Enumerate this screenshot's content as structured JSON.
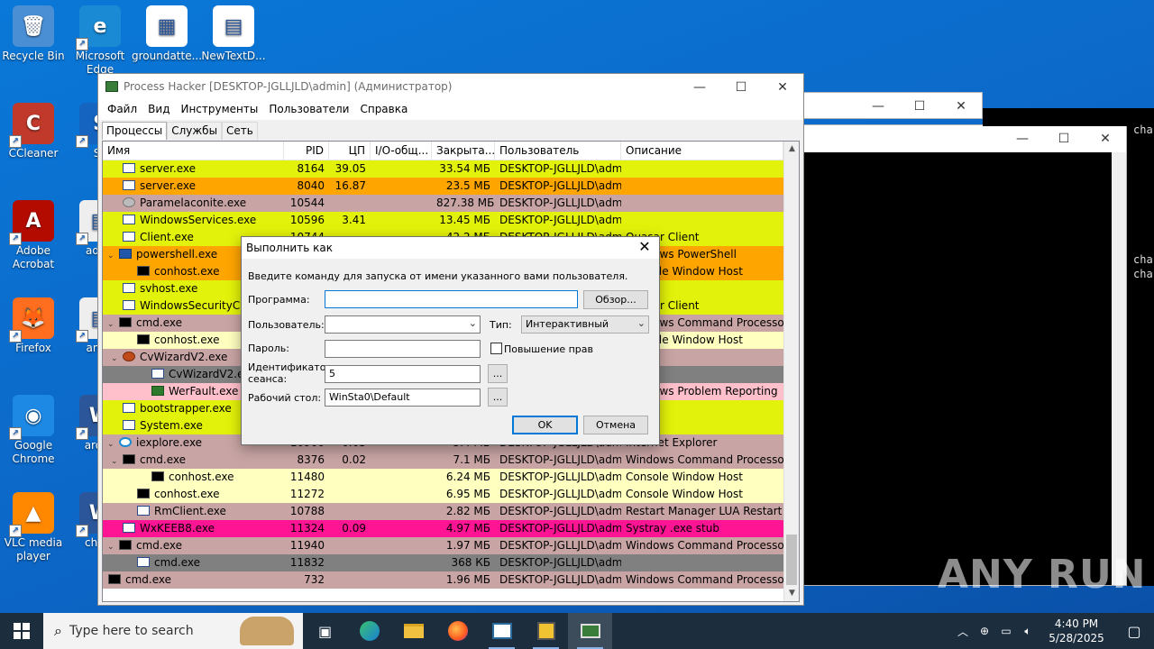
{
  "desktop": {
    "icons": [
      {
        "label": "Recycle Bin"
      },
      {
        "label": "Microsoft Edge"
      },
      {
        "label": "groundatte..."
      },
      {
        "label": "NewTextD..."
      },
      {
        "label": "CCleaner"
      },
      {
        "label": "Sk"
      },
      {
        "label": "Adobe Acrobat"
      },
      {
        "label": "advic"
      },
      {
        "label": "Firefox"
      },
      {
        "label": "answ"
      },
      {
        "label": "Google Chrome"
      },
      {
        "label": "aroun"
      },
      {
        "label": "VLC media player"
      },
      {
        "label": "charg"
      }
    ],
    "console_text": [
      "cha",
      "cha",
      "cha"
    ],
    "watermark": "ANY RUN"
  },
  "process_hacker": {
    "title": "Process Hacker [DESKTOP-JGLLJLD\\admin] (Администратор)",
    "menu": [
      "Файл",
      "Вид",
      "Инструменты",
      "Пользователи",
      "Справка"
    ],
    "tabs": [
      "Процессы",
      "Службы",
      "Сеть"
    ],
    "columns": [
      "Имя",
      "PID",
      "ЦП",
      "I/O-общ...",
      "Закрыта...",
      "Пользователь",
      "Описание"
    ],
    "rows": [
      {
        "name": "server.exe",
        "pid": "8164",
        "cpu": "39.05",
        "io": "",
        "mem": "33.54 МБ",
        "user": "DESKTOP-JGLLJLD\\admi",
        "desc": "",
        "bg": "#e3f20a",
        "indent": 1,
        "icon": "app",
        "expander": ""
      },
      {
        "name": "server.exe",
        "pid": "8040",
        "cpu": "16.87",
        "io": "",
        "mem": "23.5 МБ",
        "user": "DESKTOP-JGLLJLD\\admi",
        "desc": "",
        "bg": "#ffa500",
        "indent": 1,
        "icon": "app",
        "expander": ""
      },
      {
        "name": "Paramelaconite.exe",
        "pid": "10544",
        "cpu": "",
        "io": "",
        "mem": "827.38 МБ",
        "user": "DESKTOP-JGLLJLD\\admi",
        "desc": "",
        "bg": "#c8a4a4",
        "indent": 1,
        "icon": "gear",
        "expander": ""
      },
      {
        "name": "WindowsServices.exe",
        "pid": "10596",
        "cpu": "3.41",
        "io": "",
        "mem": "13.45 МБ",
        "user": "DESKTOP-JGLLJLD\\admi",
        "desc": "",
        "bg": "#e3f20a",
        "indent": 1,
        "icon": "app",
        "expander": ""
      },
      {
        "name": "Client.exe",
        "pid": "10744",
        "cpu": "",
        "io": "",
        "mem": "42.2 МБ",
        "user": "DESKTOP-JGLLJLD\\admi",
        "desc": "Quasar Client",
        "bg": "#e3f20a",
        "indent": 1,
        "icon": "app",
        "expander": ""
      },
      {
        "name": "powershell.exe",
        "pid": "",
        "cpu": "",
        "io": "",
        "mem": "",
        "user": "",
        "desc": "Windows PowerShell",
        "bg": "#ffa500",
        "indent": 0,
        "icon": "ps",
        "expander": "⌄"
      },
      {
        "name": "conhost.exe",
        "pid": "",
        "cpu": "",
        "io": "",
        "mem": "",
        "user": "",
        "desc": "Console Window Host",
        "bg": "#ffa500",
        "indent": 2,
        "icon": "cmd",
        "expander": ""
      },
      {
        "name": "svhost.exe",
        "pid": "",
        "cpu": "",
        "io": "",
        "mem": "",
        "user": "",
        "desc": "",
        "bg": "#e3f20a",
        "indent": 1,
        "icon": "app",
        "expander": ""
      },
      {
        "name": "WindowsSecurityChe",
        "pid": "",
        "cpu": "",
        "io": "",
        "mem": "",
        "user": "",
        "desc": "Quasar Client",
        "bg": "#e3f20a",
        "indent": 1,
        "icon": "app",
        "expander": ""
      },
      {
        "name": "cmd.exe",
        "pid": "",
        "cpu": "",
        "io": "",
        "mem": "",
        "user": "",
        "desc": "Windows Command Processor",
        "bg": "#c8a4a4",
        "indent": 0,
        "icon": "cmd",
        "expander": "⌄"
      },
      {
        "name": "conhost.exe",
        "pid": "",
        "cpu": "",
        "io": "",
        "mem": "",
        "user": "",
        "desc": "Console Window Host",
        "bg": "#ffffc0",
        "indent": 2,
        "icon": "cmd",
        "expander": ""
      },
      {
        "name": "CvWizardV2.exe",
        "pid": "",
        "cpu": "",
        "io": "",
        "mem": "",
        "user": "",
        "desc": "",
        "bg": "#c8a4a4",
        "indent": 1,
        "icon": "java",
        "expander": "⌄"
      },
      {
        "name": "CvWizardV2.exe",
        "pid": "",
        "cpu": "",
        "io": "",
        "mem": "",
        "user": "",
        "desc": "",
        "bg": "#808080",
        "indent": 3,
        "icon": "app",
        "expander": ""
      },
      {
        "name": "WerFault.exe",
        "pid": "",
        "cpu": "",
        "io": "",
        "mem": "",
        "user": "",
        "desc": "Windows Problem Reporting",
        "bg": "#ffc0cb",
        "indent": 3,
        "icon": "shield",
        "expander": ""
      },
      {
        "name": "bootstrapper.exe",
        "pid": "",
        "cpu": "",
        "io": "",
        "mem": "",
        "user": "",
        "desc": "",
        "bg": "#e3f20a",
        "indent": 1,
        "icon": "app",
        "expander": ""
      },
      {
        "name": "System.exe",
        "pid": "",
        "cpu": "",
        "io": "",
        "mem": "",
        "user": "",
        "desc": "",
        "bg": "#e3f20a",
        "indent": 1,
        "icon": "app",
        "expander": ""
      },
      {
        "name": "iexplore.exe",
        "pid": "10900",
        "cpu": "0.05",
        "io": "",
        "mem": "3.4 МБ",
        "user": "DESKTOP-JGLLJLD\\admi",
        "desc": "Internet Explorer",
        "bg": "#c8a4a4",
        "indent": 0,
        "icon": "ie",
        "expander": "⌄"
      },
      {
        "name": "cmd.exe",
        "pid": "8376",
        "cpu": "0.02",
        "io": "",
        "mem": "7.1 МБ",
        "user": "DESKTOP-JGLLJLD\\admi",
        "desc": "Windows Command Processor",
        "bg": "#c8a4a4",
        "indent": 1,
        "icon": "cmd",
        "expander": "⌄"
      },
      {
        "name": "conhost.exe",
        "pid": "11480",
        "cpu": "",
        "io": "",
        "mem": "6.24 МБ",
        "user": "DESKTOP-JGLLJLD\\admi",
        "desc": "Console Window Host",
        "bg": "#ffffc0",
        "indent": 3,
        "icon": "cmd",
        "expander": ""
      },
      {
        "name": "conhost.exe",
        "pid": "11272",
        "cpu": "",
        "io": "",
        "mem": "6.95 МБ",
        "user": "DESKTOP-JGLLJLD\\admi",
        "desc": "Console Window Host",
        "bg": "#ffffc0",
        "indent": 2,
        "icon": "cmd",
        "expander": ""
      },
      {
        "name": "RmClient.exe",
        "pid": "10788",
        "cpu": "",
        "io": "",
        "mem": "2.82 МБ",
        "user": "DESKTOP-JGLLJLD\\admi",
        "desc": "Restart Manager LUA Restart ...",
        "bg": "#c8a4a4",
        "indent": 2,
        "icon": "app",
        "expander": ""
      },
      {
        "name": "WxKEEB8.exe",
        "pid": "11324",
        "cpu": "0.09",
        "io": "",
        "mem": "4.97 МБ",
        "user": "DESKTOP-JGLLJLD\\admi",
        "desc": "Systray .exe stub",
        "bg": "#ff1493",
        "indent": 1,
        "icon": "app",
        "expander": ""
      },
      {
        "name": "cmd.exe",
        "pid": "11940",
        "cpu": "",
        "io": "",
        "mem": "1.97 МБ",
        "user": "DESKTOP-JGLLJLD\\admi",
        "desc": "Windows Command Processor",
        "bg": "#c8a4a4",
        "indent": 0,
        "icon": "cmd",
        "expander": "⌄"
      },
      {
        "name": "cmd.exe",
        "pid": "11832",
        "cpu": "",
        "io": "",
        "mem": "368 КБ",
        "user": "DESKTOP-JGLLJLD\\admi",
        "desc": "",
        "bg": "#808080",
        "indent": 2,
        "icon": "app",
        "expander": ""
      },
      {
        "name": "cmd.exe",
        "pid": "732",
        "cpu": "",
        "io": "",
        "mem": "1.96 МБ",
        "user": "DESKTOP-JGLLJLD\\admi",
        "desc": "Windows Command Processor",
        "bg": "#c8a4a4",
        "indent": 0,
        "icon": "cmd",
        "expander": ""
      }
    ]
  },
  "run_as": {
    "title": "Выполнить как",
    "instruction": "Введите команду для запуска от имени указанного вами пользователя.",
    "program_label": "Программа:",
    "program_value": "",
    "browse_label": "Обзор...",
    "user_label": "Пользователь:",
    "user_value": "",
    "type_label": "Тип:",
    "type_value": "Интерактивный",
    "password_label": "Пароль:",
    "elevate_label": "Повышение прав",
    "session_label": "Идентификатор сеанса:",
    "session_value": "5",
    "desktop_label": "Рабочий стол:",
    "desktop_value": "WinSta0\\Default",
    "ellipsis": "...",
    "ok_label": "OK",
    "cancel_label": "Отмена"
  },
  "taskbar": {
    "search_placeholder": "Type here to search",
    "time": "4:40 PM",
    "date": "5/28/2025"
  }
}
